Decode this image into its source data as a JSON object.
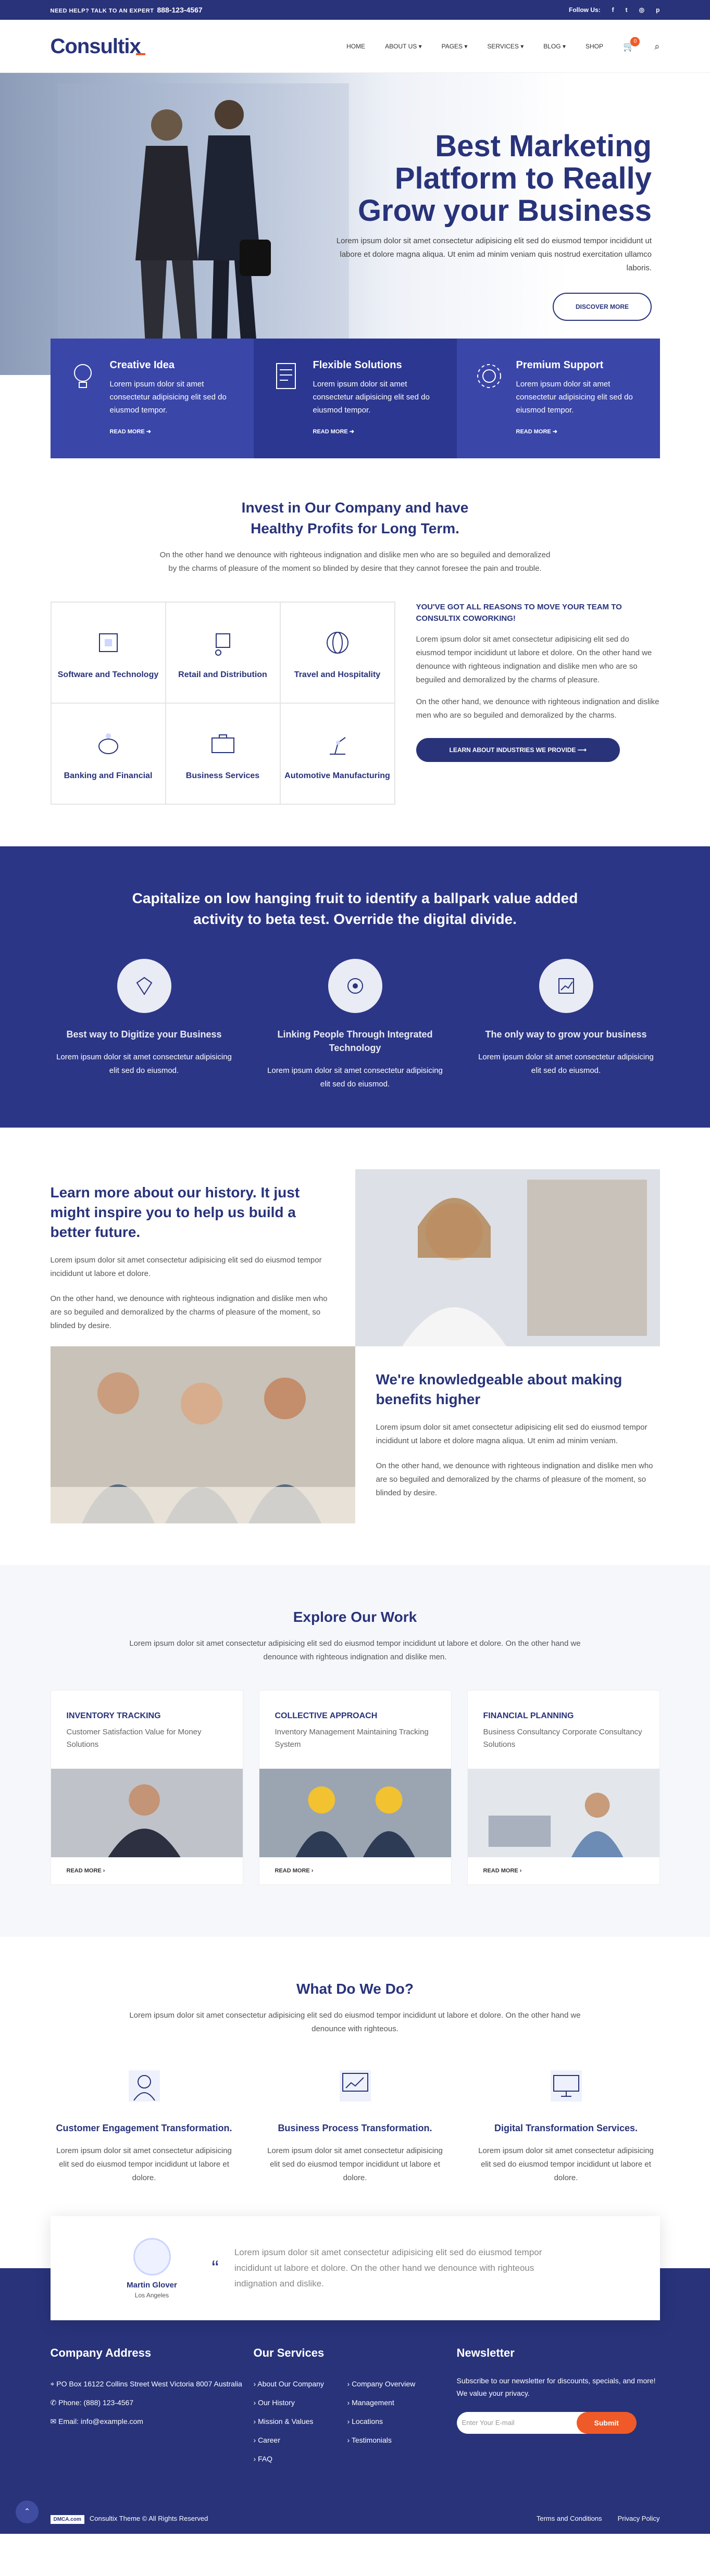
{
  "topbar": {
    "label": "NEED HELP? TALK TO AN EXPERT",
    "phone": "888-123-4567",
    "follow": "Follow Us:"
  },
  "brand": {
    "logo": "Consultix",
    "accent": "#f05a28",
    "primary": "#28337a"
  },
  "nav": {
    "items": [
      "HOME",
      "ABOUT US",
      "PAGES",
      "SERVICES",
      "BLOG",
      "SHOP"
    ],
    "cart_count": "0"
  },
  "hero": {
    "title_1": "Best Marketing",
    "title_2": "Platform to Really",
    "title_3": "Grow your Business",
    "text": "Lorem ipsum dolor sit amet consectetur adipisicing elit sed do eiusmod tempor incididunt ut labore et dolore magna aliqua. Ut enim ad minim veniam quis nostrud exercitation ullamco laboris.",
    "button": "DISCOVER MORE"
  },
  "features": [
    {
      "title": "Creative Idea",
      "text": "Lorem ipsum dolor sit amet consectetur adipisicing elit sed do eiusmod tempor.",
      "more": "READ MORE"
    },
    {
      "title": "Flexible Solutions",
      "text": "Lorem ipsum dolor sit amet consectetur adipisicing elit sed do eiusmod tempor.",
      "more": "READ MORE"
    },
    {
      "title": "Premium Support",
      "text": "Lorem ipsum dolor sit amet consectetur adipisicing elit sed do eiusmod tempor.",
      "more": "READ MORE"
    }
  ],
  "invest": {
    "title_1": "Invest in Our Company and have",
    "title_2": "Healthy Profits for Long Term.",
    "sub": "On the other hand we denounce with righteous indignation and dislike men who are so beguiled and demoralized by the charms of pleasure of the moment so blinded by desire that they cannot foresee the pain and trouble.",
    "industries": [
      "Software and Technology",
      "Retail and Distribution",
      "Travel and Hospitality",
      "Banking and Financial",
      "Business Services",
      "Automotive Manufacturing"
    ],
    "side_title": "YOU'VE GOT ALL REASONS TO MOVE YOUR TEAM TO CONSULTIX COWORKING!",
    "side_p1": "Lorem ipsum dolor sit amet consectetur adipisicing elit sed do eiusmod tempor incididunt ut labore et dolore. On the other hand we denounce with righteous indignation and dislike men who are so beguiled and demoralized by the charms of pleasure.",
    "side_p2": "On the other hand, we denounce with righteous indignation and dislike men who are so beguiled and demoralized by the charms.",
    "button": "LEARN ABOUT INDUSTRIES WE PROVIDE"
  },
  "band": {
    "title": "Capitalize on low hanging fruit to identify a ballpark value added activity to beta test. Override the digital divide.",
    "cols": [
      {
        "title": "Best way to Digitize your Business",
        "text": "Lorem ipsum dolor sit amet consectetur adipisicing elit sed do eiusmod."
      },
      {
        "title": "Linking People Through Integrated Technology",
        "text": "Lorem ipsum dolor sit amet consectetur adipisicing elit sed do eiusmod."
      },
      {
        "title": "The only way to grow your business",
        "text": "Lorem ipsum dolor sit amet consectetur adipisicing elit sed do eiusmod."
      }
    ]
  },
  "history": {
    "title": "Learn more about our history. It just might inspire you to help us build a better future.",
    "p1": "Lorem ipsum dolor sit amet consectetur adipisicing elit sed do eiusmod tempor incididunt ut labore et dolore.",
    "p2": "On the other hand, we denounce with righteous indignation and dislike men who are so beguiled and demoralized by the charms of pleasure of the moment, so blinded by desire.",
    "title2": "We're knowledgeable about making benefits higher",
    "p3": "Lorem ipsum dolor sit amet consectetur adipisicing elit sed do eiusmod tempor incididunt ut labore et dolore magna aliqua. Ut enim ad minim veniam.",
    "p4": "On the other hand, we denounce with righteous indignation and dislike men who are so beguiled and demoralized by the charms of pleasure of the moment, so blinded by desire."
  },
  "explore": {
    "title": "Explore Our Work",
    "sub": "Lorem ipsum dolor sit amet consectetur adipisicing elit sed do eiusmod tempor incididunt ut labore et dolore. On the other hand we denounce with righteous indignation and dislike men.",
    "cards": [
      {
        "title": "INVENTORY TRACKING",
        "text": "Customer Satisfaction Value for Money Solutions",
        "more": "READ MORE"
      },
      {
        "title": "COLLECTIVE APPROACH",
        "text": "Inventory Management Maintaining Tracking System",
        "more": "READ MORE"
      },
      {
        "title": "FINANCIAL PLANNING",
        "text": "Business Consultancy Corporate Consultancy Solutions",
        "more": "READ MORE"
      }
    ]
  },
  "whatdo": {
    "title": "What Do We Do?",
    "sub": "Lorem ipsum dolor sit amet consectetur adipisicing elit sed do eiusmod tempor incididunt ut labore et dolore. On the other hand we denounce with righteous.",
    "cols": [
      {
        "title": "Customer Engagement Transformation.",
        "text": "Lorem ipsum dolor sit amet consectetur adipisicing elit sed do eiusmod tempor incididunt ut labore et dolore."
      },
      {
        "title": "Business Process Transformation.",
        "text": "Lorem ipsum dolor sit amet consectetur adipisicing elit sed do eiusmod tempor incididunt ut labore et dolore."
      },
      {
        "title": "Digital Transformation Services.",
        "text": "Lorem ipsum dolor sit amet consectetur adipisicing elit sed do eiusmod tempor incididunt ut labore et dolore."
      }
    ]
  },
  "testimonial": {
    "name": "Martin Glover",
    "location": "Los Angeles",
    "text": "Lorem ipsum dolor sit amet consectetur adipisicing elit sed do eiusmod tempor incididunt ut labore et dolore. On the other hand we denounce with righteous indignation and dislike."
  },
  "footer": {
    "address_title": "Company Address",
    "address": "PO Box 16122 Collins Street West Victoria 8007 Australia",
    "phone": "Phone: (888) 123-4567",
    "email": "Email: info@example.com",
    "services_title": "Our Services",
    "services": [
      "About Our Company",
      "Company Overview",
      "Our History",
      "Management",
      "Mission & Values",
      "Locations",
      "Career",
      "Testimonials",
      "FAQ"
    ],
    "news_title": "Newsletter",
    "news_text": "Subscribe to our newsletter for discounts, specials, and more! We value your privacy.",
    "email_placeholder": "Enter Your E-mail",
    "submit": "Submit",
    "copyright": "Consultix Theme © All Rights Reserved",
    "terms": "Terms and Conditions",
    "privacy": "Privacy Policy",
    "dmca": "DMCA.com"
  }
}
